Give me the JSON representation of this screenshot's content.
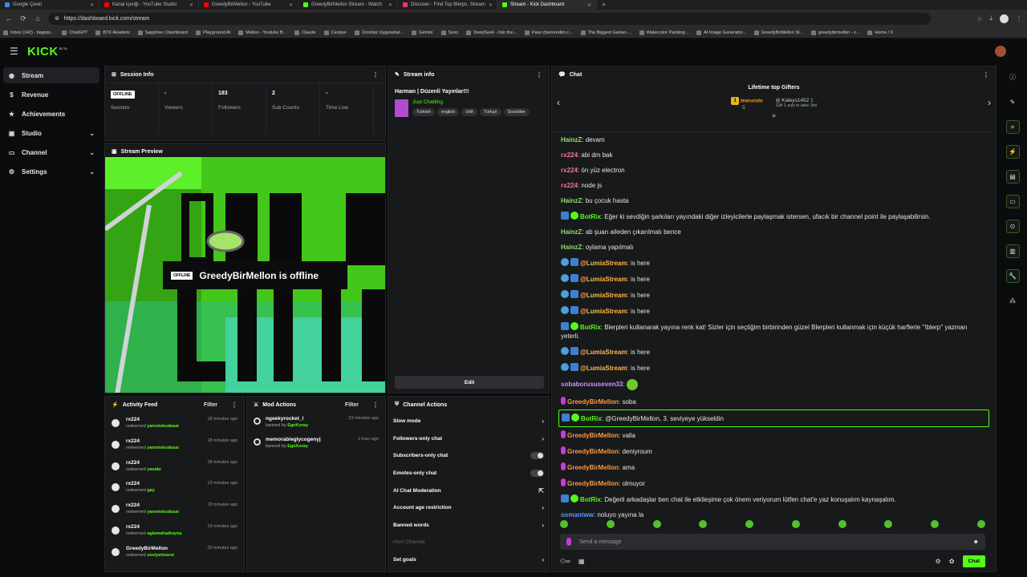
{
  "browser": {
    "tabs": [
      {
        "title": "Google Çeviri",
        "color": "#4285f4"
      },
      {
        "title": "Kanal içeriği - YouTube Studio",
        "color": "#ff0000"
      },
      {
        "title": "GreedyBirMellon - YouTube",
        "color": "#ff0000"
      },
      {
        "title": "GreedyBirMellon Stream - Watch",
        "color": "#53fc18"
      },
      {
        "title": "Discover - Find Top Blerps, Stream",
        "color": "#ff2d6f"
      },
      {
        "title": "Stream - Kick Dashboard",
        "color": "#53fc18"
      }
    ],
    "url": "https://dashboard.kick.com/stream",
    "bookmarks": [
      "Inbox (142) - bagisis...",
      "ChatGPT",
      "BTK Akademi",
      "Sapphire | Dashboard",
      "Playground AI",
      "Mellon - Youtube B...",
      "Claude",
      "Camper",
      "Ücretsiz Uygulamal...",
      "Gemini",
      "Suno",
      "DeepSeek - Into the...",
      "Paso (benrendim.c...",
      "The Biggest Gamer-...",
      "Watercolor Painting...",
      "AI Image Generator...",
      "GreedyBirMellon St...",
      "greedybirmellon - s...",
      "Home / X"
    ]
  },
  "app": {
    "logo": "KICK",
    "beta": "BETA"
  },
  "sidebar": [
    {
      "label": "Stream",
      "icon": "broadcast-icon",
      "active": true
    },
    {
      "label": "Revenue",
      "icon": "dollar-icon"
    },
    {
      "label": "Achievements",
      "icon": "trophy-icon"
    },
    {
      "label": "Studio",
      "icon": "camera-icon",
      "chev": true
    },
    {
      "label": "Channel",
      "icon": "channel-icon",
      "chev": true
    },
    {
      "label": "Settings",
      "icon": "gear-icon",
      "chev": true
    }
  ],
  "session": {
    "title": "Session Info",
    "cells": [
      {
        "value": "OFFLINE",
        "label": "Session"
      },
      {
        "value": "-",
        "label": "Viewers"
      },
      {
        "value": "183",
        "label": "Followers"
      },
      {
        "value": "2",
        "label": "Sub Counts"
      },
      {
        "value": "-",
        "label": "Time Live"
      }
    ]
  },
  "preview": {
    "title": "Stream Preview",
    "badge": "OFFLINE",
    "message": "GreedyBirMellon is offline"
  },
  "stream_info": {
    "title": "Stream info",
    "stream_title": "Harman | Düzenli Yayınlar!!!",
    "category": "Just Chatting",
    "tags": [
      "Turkish",
      "english",
      "chill",
      "Türkçe",
      "Soulslike"
    ],
    "edit": "Edit"
  },
  "activity": {
    "title": "Activity Feed",
    "filter": "Filter",
    "items": [
      {
        "user": "rx224",
        "action": "redeemed",
        "reward": "yametekudasai",
        "time": "18 minutes ago"
      },
      {
        "user": "rx224",
        "action": "redeemed",
        "reward": "yametekudasai",
        "time": "18 minutes ago"
      },
      {
        "user": "rx224",
        "action": "redeemed",
        "reward": "yasabr",
        "time": "18 minutes ago"
      },
      {
        "user": "rx224",
        "action": "redeemed",
        "reward": "gay",
        "time": "19 minutes ago"
      },
      {
        "user": "rx224",
        "action": "redeemed",
        "reward": "yametekudasai",
        "time": "19 minutes ago"
      },
      {
        "user": "rx224",
        "action": "redeemed",
        "reward": "aglamahadioyna",
        "time": "19 minutes ago"
      },
      {
        "user": "GreedyBirMellon",
        "action": "redeemed",
        "reward": "soviyetmarsi",
        "time": "20 minutes ago"
      }
    ]
  },
  "mod": {
    "title": "Mod Actions",
    "filter": "Filter",
    "items": [
      {
        "user": "ngeekyrocket_l",
        "action": "banned by",
        "by": "EgeKoray",
        "time": "23 minutes ago"
      },
      {
        "user": "memorableglycogenyj",
        "action": "banned by",
        "by": "EgeKoray",
        "time": "1 hour ago"
      }
    ]
  },
  "channel_actions": {
    "title": "Channel Actions",
    "items": [
      {
        "label": "Slow mode",
        "kind": "arrow"
      },
      {
        "label": "Followers-only chat",
        "kind": "arrow"
      },
      {
        "label": "Subscribers-only chat",
        "kind": "toggle"
      },
      {
        "label": "Emotes-only chat",
        "kind": "toggle"
      },
      {
        "label": "AI Chat Moderation",
        "kind": "ext"
      },
      {
        "label": "Account age restriction",
        "kind": "arrow"
      },
      {
        "label": "Banned words",
        "kind": "arrow"
      },
      {
        "label": "Host Channel",
        "kind": "dim"
      },
      {
        "label": "Set goals",
        "kind": "arrow"
      }
    ]
  },
  "chat": {
    "title": "Chat",
    "gifters_title": "Lifetime top Gifters",
    "gifter1": {
      "rank": "1",
      "name": "tearundo",
      "count": "5"
    },
    "gifter2": {
      "name": "Kaleys1452",
      "count": "1",
      "note": "Gift 1 sub to take 3rd"
    },
    "messages": [
      {
        "user": "HainzZ",
        "color": "#8fe06a",
        "text": "devam",
        "badges": []
      },
      {
        "user": "rx224",
        "color": "#ff6e9a",
        "text": "abi dm bak",
        "badges": []
      },
      {
        "user": "rx224",
        "color": "#ff6e9a",
        "text": "ön yüz electron",
        "badges": []
      },
      {
        "user": "rx224",
        "color": "#ff6e9a",
        "text": "node js",
        "badges": []
      },
      {
        "user": "HainzZ",
        "color": "#8fe06a",
        "text": "bu çocuk hasta",
        "badges": []
      },
      {
        "user": "BotRix",
        "color": "#53fc18",
        "text": "Eğer ki sevdiğin şarkıları yayındaki diğer izleyicilerle paylaşmak istersen, ufacık bir channel point ile paylaşabilirsin.",
        "badges": [
          "bot",
          "ver"
        ]
      },
      {
        "user": "HainzZ",
        "color": "#8fe06a",
        "text": "ab şuan aileden çıkarılmalı bence",
        "badges": []
      },
      {
        "user": "HainzZ",
        "color": "#8fe06a",
        "text": "oylama yapılmalı",
        "badges": []
      },
      {
        "user": "@LumiaStream",
        "color": "#ffb84a",
        "text": "is here",
        "badges": [
          "lumia",
          "bot"
        ]
      },
      {
        "user": "@LumiaStream",
        "color": "#ffb84a",
        "text": "is here",
        "badges": [
          "lumia",
          "bot"
        ]
      },
      {
        "user": "@LumiaStream",
        "color": "#ffb84a",
        "text": "is here",
        "badges": [
          "lumia",
          "bot"
        ]
      },
      {
        "user": "@LumiaStream",
        "color": "#ffb84a",
        "text": "is here",
        "badges": [
          "lumia",
          "bot"
        ]
      },
      {
        "user": "BotRix",
        "color": "#53fc18",
        "text": "Blerpleri kullanarak yayına renk kat! Sizler için seçtiğim birbirinden güzel Blerpleri kullanmak için küçük harflerle \"!blerp\" yazman yeterli.",
        "badges": [
          "bot",
          "ver"
        ]
      },
      {
        "user": "@LumiaStream",
        "color": "#ffb84a",
        "text": "is here",
        "badges": [
          "lumia",
          "bot"
        ]
      },
      {
        "user": "@LumiaStream",
        "color": "#ffb84a",
        "text": "is here",
        "badges": [
          "lumia",
          "bot"
        ]
      },
      {
        "user": "sobaborususeven33",
        "color": "#c794ff",
        "text": "",
        "badges": [],
        "emote": true
      },
      {
        "user": "GreedyBirMellon",
        "color": "#ff9a3c",
        "text": "soba",
        "badges": [
          "mic"
        ]
      },
      {
        "user": "BotRix",
        "color": "#53fc18",
        "text": "@GreedyBirMellon, 3. seviyeye yükseldin",
        "badges": [
          "bot",
          "ver"
        ],
        "hl": true
      },
      {
        "user": "GreedyBirMellon",
        "color": "#ff9a3c",
        "text": "valla",
        "badges": [
          "mic"
        ]
      },
      {
        "user": "GreedyBirMellon",
        "color": "#ff9a3c",
        "text": "deniyroum",
        "badges": [
          "mic"
        ]
      },
      {
        "user": "GreedyBirMellon",
        "color": "#ff9a3c",
        "text": "ama",
        "badges": [
          "mic"
        ]
      },
      {
        "user": "GreedyBirMellon",
        "color": "#ff9a3c",
        "text": "olmuyor",
        "badges": [
          "mic"
        ]
      },
      {
        "user": "BotRix",
        "color": "#53fc18",
        "text": "Değerli arkadaşlar ben chat ile etkileşime çok önem veriyorum lütfen chat'e yaz konuşalım kaynaşalım.",
        "badges": [
          "bot",
          "ver"
        ]
      },
      {
        "user": "osmantww",
        "color": "#5b9bff",
        "text": "noluyo yayına la",
        "badges": []
      }
    ],
    "placeholder": "Send a message",
    "send": "Chat"
  }
}
